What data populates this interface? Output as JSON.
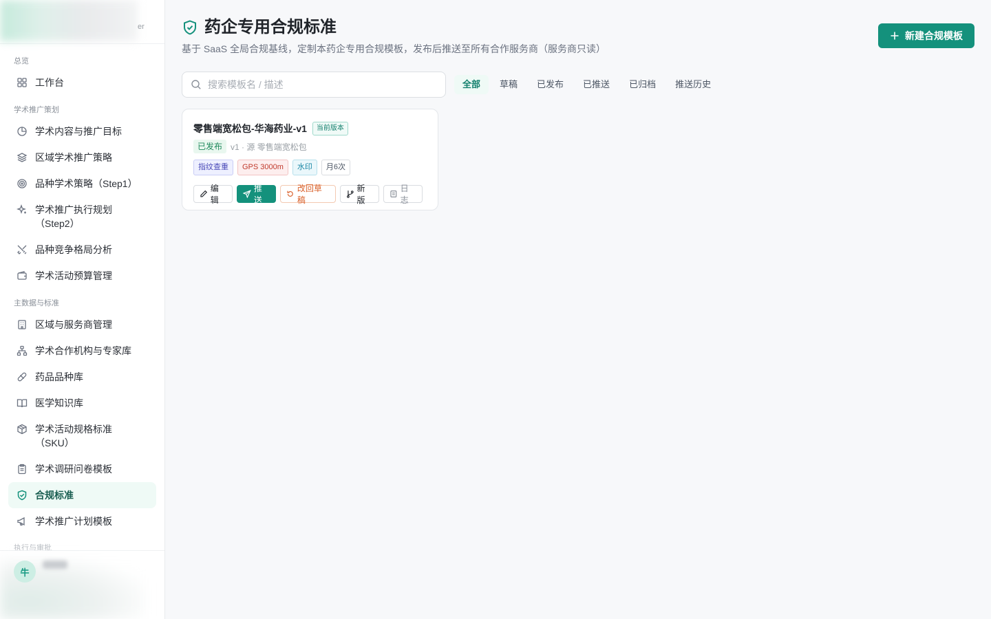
{
  "brand": {
    "subtitle": "er"
  },
  "sidebar": {
    "groups": [
      {
        "title": "总览",
        "items": [
          {
            "label": "工作台",
            "icon": "dashboard-grid-icon"
          }
        ]
      },
      {
        "title": "学术推广策划",
        "items": [
          {
            "label": "学术内容与推广目标",
            "icon": "target-chart-icon"
          },
          {
            "label": "区域学术推广策略",
            "icon": "layers-icon"
          },
          {
            "label": "品种学术策略（Step1）",
            "icon": "radar-target-icon"
          },
          {
            "label": "学术推广执行规划\n（Step2）",
            "icon": "sparkles-icon"
          },
          {
            "label": "品种竞争格局分析",
            "icon": "swords-icon"
          },
          {
            "label": "学术活动预算管理",
            "icon": "wallet-icon"
          }
        ]
      },
      {
        "title": "主数据与标准",
        "items": [
          {
            "label": "区域与服务商管理",
            "icon": "building-icon"
          },
          {
            "label": "学术合作机构与专家库",
            "icon": "network-icon"
          },
          {
            "label": "药品品种库",
            "icon": "pill-icon"
          },
          {
            "label": "医学知识库",
            "icon": "book-icon"
          },
          {
            "label": "学术活动规格标准\n（SKU）",
            "icon": "package-icon"
          },
          {
            "label": "学术调研问卷模板",
            "icon": "clipboard-icon"
          },
          {
            "label": "合规标准",
            "icon": "shield-check-icon",
            "active": true
          },
          {
            "label": "学术推广计划模板",
            "icon": "megaphone-icon"
          }
        ]
      }
    ],
    "next_group_title": "执行与审批",
    "user": {
      "avatar_text": "牛"
    }
  },
  "header": {
    "title": "药企专用合规标准",
    "description": "基于 SaaS 全局合规基线，定制本药企专用合规模板，发布后推送至所有合作服务商（服务商只读）",
    "new_button": "新建合规模板"
  },
  "search": {
    "placeholder": "搜索模板名 / 描述",
    "value": ""
  },
  "tabs": [
    {
      "label": "全部",
      "active": true
    },
    {
      "label": "草稿"
    },
    {
      "label": "已发布"
    },
    {
      "label": "已推送"
    },
    {
      "label": "已归档"
    },
    {
      "label": "推送历史"
    }
  ],
  "templates": [
    {
      "name": "零售端宽松包-华海药业-v1",
      "current_badge": "当前版本",
      "status": "已发布",
      "meta": "v1 · 源 零售端宽松包",
      "tags": [
        "指纹查重",
        "GPS 3000m",
        "水印",
        "月6次"
      ],
      "actions": {
        "edit": "编辑",
        "push": "推送",
        "revert": "改回草稿",
        "new_version": "新版",
        "log": "日志"
      }
    }
  ],
  "colors": {
    "accent": "#14917c",
    "active_bg": "#effaf6",
    "published": "#1f8a5c",
    "revert": "#d9602a"
  }
}
